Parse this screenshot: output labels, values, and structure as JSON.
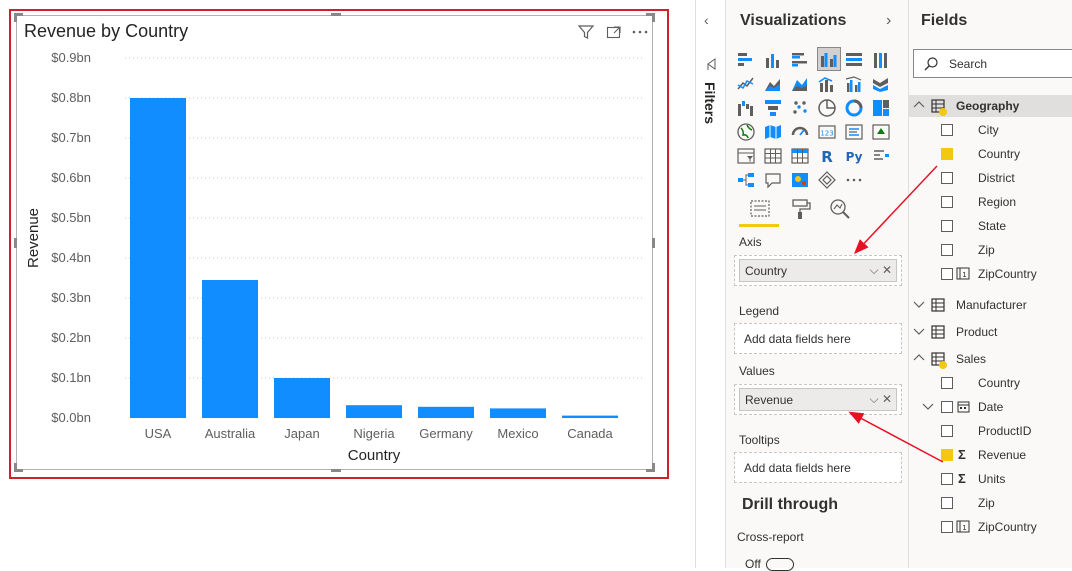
{
  "chart_data": {
    "type": "bar",
    "title": "Revenue by Country",
    "xlabel": "Country",
    "ylabel": "Revenue",
    "categories": [
      "USA",
      "Australia",
      "Japan",
      "Nigeria",
      "Germany",
      "Mexico",
      "Canada"
    ],
    "values": [
      0.8,
      0.345,
      0.1,
      0.032,
      0.028,
      0.024,
      0.006
    ],
    "ylim": [
      0,
      0.9
    ],
    "yticks": [
      {
        "value": 0.0,
        "label": "$0.0bn"
      },
      {
        "value": 0.1,
        "label": "$0.1bn"
      },
      {
        "value": 0.2,
        "label": "$0.2bn"
      },
      {
        "value": 0.3,
        "label": "$0.3bn"
      },
      {
        "value": 0.4,
        "label": "$0.4bn"
      },
      {
        "value": 0.5,
        "label": "$0.5bn"
      },
      {
        "value": 0.6,
        "label": "$0.6bn"
      },
      {
        "value": 0.7,
        "label": "$0.7bn"
      },
      {
        "value": 0.8,
        "label": "$0.8bn"
      },
      {
        "value": 0.9,
        "label": "$0.9bn"
      }
    ],
    "grid": true,
    "bar_color": "#118dff"
  },
  "visual_header": {
    "icons": [
      "filter-icon",
      "focus-mode-icon",
      "more-options-icon"
    ]
  },
  "filters_pane": {
    "label": "Filters"
  },
  "visualizations": {
    "title": "Visualizations",
    "tabs": [
      "fields-tab",
      "format-tab",
      "analytics-tab"
    ],
    "wells": {
      "axis": {
        "label": "Axis",
        "field": "Country"
      },
      "legend": {
        "label": "Legend",
        "placeholder": "Add data fields here"
      },
      "values": {
        "label": "Values",
        "field": "Revenue"
      },
      "tooltips": {
        "label": "Tooltips",
        "placeholder": "Add data fields here"
      }
    },
    "drill_through": {
      "title": "Drill through",
      "cross_report": "Cross-report",
      "toggle": "Off"
    }
  },
  "fields": {
    "title": "Fields",
    "search_placeholder": "Search",
    "tables": [
      {
        "name": "Geography",
        "expanded": true,
        "fields": [
          {
            "name": "City",
            "checked": false
          },
          {
            "name": "Country",
            "checked": true
          },
          {
            "name": "District",
            "checked": false
          },
          {
            "name": "Region",
            "checked": false
          },
          {
            "name": "State",
            "checked": false
          },
          {
            "name": "Zip",
            "checked": false
          },
          {
            "name": "ZipCountry",
            "checked": false
          }
        ]
      },
      {
        "name": "Manufacturer",
        "expanded": false,
        "fields": []
      },
      {
        "name": "Product",
        "expanded": false,
        "fields": []
      },
      {
        "name": "Sales",
        "expanded": true,
        "fields": [
          {
            "name": "Country",
            "checked": false
          },
          {
            "name": "Date",
            "checked": false
          },
          {
            "name": "ProductID",
            "checked": false
          },
          {
            "name": "Revenue",
            "checked": true
          },
          {
            "name": "Units",
            "checked": false
          },
          {
            "name": "Zip",
            "checked": false
          },
          {
            "name": "ZipCountry",
            "checked": false
          }
        ]
      }
    ]
  },
  "colors": {
    "accent": "#f2c811",
    "highlight_border": "#d0202b",
    "arrow": "#e81123"
  }
}
